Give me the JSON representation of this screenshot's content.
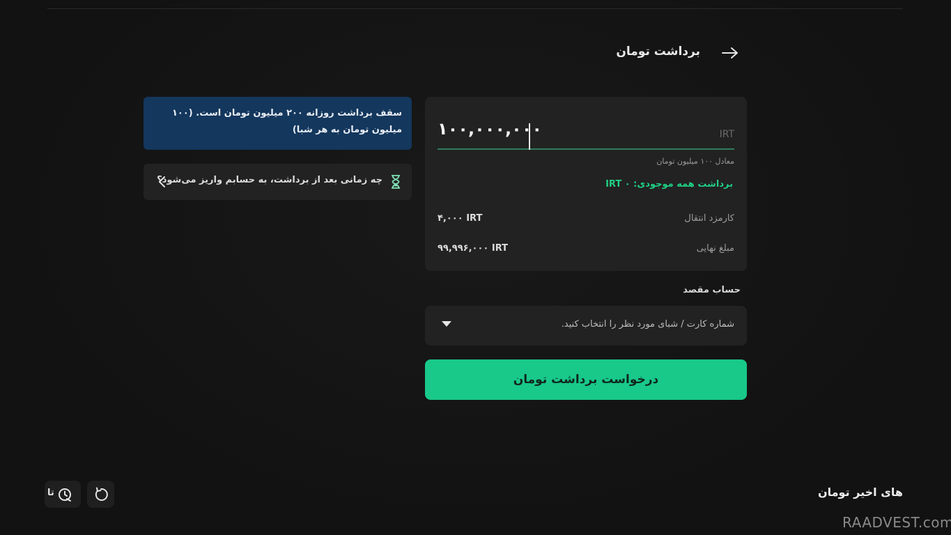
{
  "header": {
    "title": "برداشت تومان",
    "back_icon": "arrow-right-icon"
  },
  "form": {
    "amount_value": "۱۰۰,۰۰۰,۰۰۰",
    "currency": "IRT",
    "equivalent_text": "معادل ۱۰۰ میلیون تومان",
    "withdraw_all_label": "برداشت همه موجودی: IRT ۰",
    "fee_label": "کارمزد انتقال",
    "fee_value": "۴,۰۰۰ IRT",
    "final_label": "مبلغ نهایی",
    "final_value": "۹۹,۹۹۶,۰۰۰ IRT",
    "accent_color": "#1fcf84"
  },
  "destination": {
    "label": "حساب مقصد",
    "placeholder": "شماره کارت / شبای مورد نظر را انتخاب کنید."
  },
  "submit": {
    "label": "درخواست برداشت تومان",
    "color": "#18c98a"
  },
  "info": {
    "text": "سقف برداشت روزانه ۲۰۰ میلیون تومان است. (۱۰۰ میلیون تومان به هر شبا)",
    "background": "#14375d"
  },
  "faq": {
    "text": "چه زمانی بعد از برداشت، به حسابم واریز می‌شود؟",
    "icon": "hourglass-icon"
  },
  "recent": {
    "title": "های اخیر تومان",
    "history_label": "تا",
    "history_icon": "clock-history-icon",
    "refresh_icon": "refresh-icon"
  },
  "watermark": "RAADVEST.com"
}
